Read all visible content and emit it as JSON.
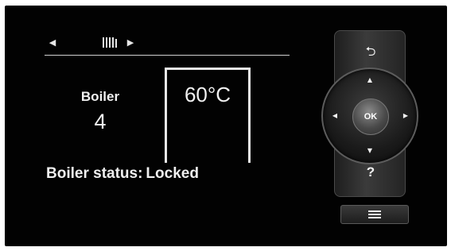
{
  "screen": {
    "nav_prev_icon": "◀",
    "nav_next_icon": "▶",
    "radiator_icon": "radiator-icon",
    "boiler_label": "Boiler",
    "boiler_number": "4",
    "temperature": "60°C",
    "status_label": "Boiler status:",
    "status_value": "Locked"
  },
  "controls": {
    "back_icon": "⮌",
    "up_icon": "▲",
    "down_icon": "▼",
    "left_icon": "◀",
    "right_icon": "▶",
    "ok_label": "OK",
    "help_label": "?",
    "menu_icon": "menu-icon"
  },
  "colors": {
    "background": "#020202",
    "text": "#f0f0f0",
    "panel": "#2c2c2c"
  }
}
